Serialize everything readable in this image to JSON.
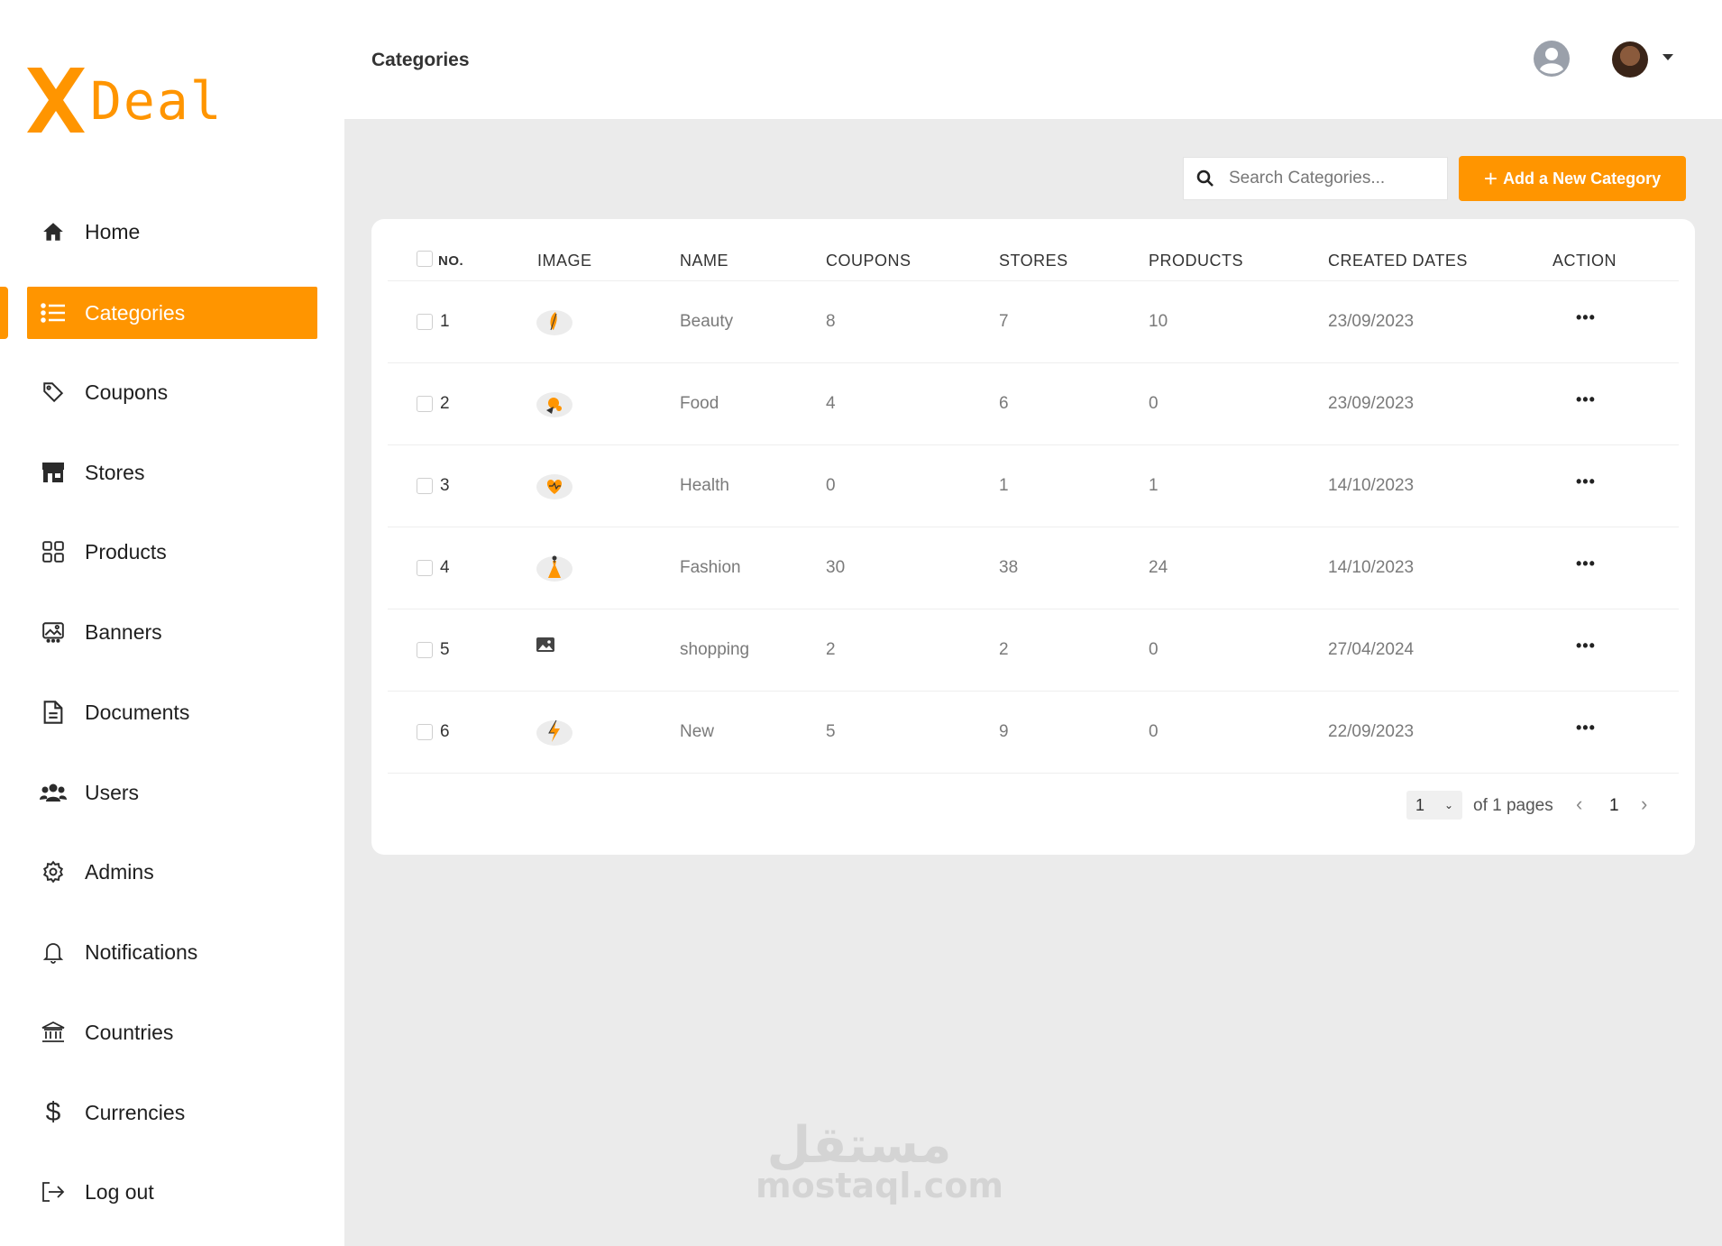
{
  "brand": {
    "name": "Deal",
    "accent": "#ff9500"
  },
  "header": {
    "title": "Categories"
  },
  "sidebar": {
    "items": [
      {
        "label": "Home",
        "icon": "home-icon"
      },
      {
        "label": "Categories",
        "icon": "list-icon",
        "active": true
      },
      {
        "label": "Coupons",
        "icon": "tag-icon"
      },
      {
        "label": "Stores",
        "icon": "store-icon"
      },
      {
        "label": "Products",
        "icon": "grid-icon"
      },
      {
        "label": "Banners",
        "icon": "image-icon"
      },
      {
        "label": "Documents",
        "icon": "document-icon"
      },
      {
        "label": "Users",
        "icon": "users-icon"
      },
      {
        "label": "Admins",
        "icon": "gear-icon"
      },
      {
        "label": "Notifications",
        "icon": "bell-icon"
      },
      {
        "label": "Countries",
        "icon": "bank-icon"
      },
      {
        "label": "Currencies",
        "icon": "dollar-icon"
      },
      {
        "label": "Log out",
        "icon": "logout-icon"
      }
    ]
  },
  "toolbar": {
    "search_placeholder": "Search Categories...",
    "add_label": "Add a New Category"
  },
  "table": {
    "columns": [
      "NO.",
      "IMAGE",
      "NAME",
      "COUPONS",
      "STORES",
      "PRODUCTS",
      "CREATED DATES",
      "ACTION"
    ],
    "rows": [
      {
        "no": "1",
        "image": "beauty-thumbnail",
        "name": "Beauty",
        "coupons": "8",
        "stores": "7",
        "products": "10",
        "created": "23/09/2023"
      },
      {
        "no": "2",
        "image": "food-thumbnail",
        "name": "Food",
        "coupons": "4",
        "stores": "6",
        "products": "0",
        "created": "23/09/2023"
      },
      {
        "no": "3",
        "image": "health-thumbnail",
        "name": "Health",
        "coupons": "0",
        "stores": "1",
        "products": "1",
        "created": "14/10/2023"
      },
      {
        "no": "4",
        "image": "fashion-thumbnail",
        "name": "Fashion",
        "coupons": "30",
        "stores": "38",
        "products": "24",
        "created": "14/10/2023"
      },
      {
        "no": "5",
        "image": "placeholder-image-icon",
        "name": "shopping",
        "coupons": "2",
        "stores": "2",
        "products": "0",
        "created": "27/04/2024"
      },
      {
        "no": "6",
        "image": "new-thumbnail",
        "name": "New",
        "coupons": "5",
        "stores": "9",
        "products": "0",
        "created": "22/09/2023"
      }
    ],
    "action_label": "•••"
  },
  "pagination": {
    "page_select": "1",
    "of_text": "of 1 pages",
    "current": "1",
    "prev": "‹",
    "next": "›"
  },
  "watermark": {
    "arabic": "مستقل",
    "latin": "mostaql.com"
  }
}
